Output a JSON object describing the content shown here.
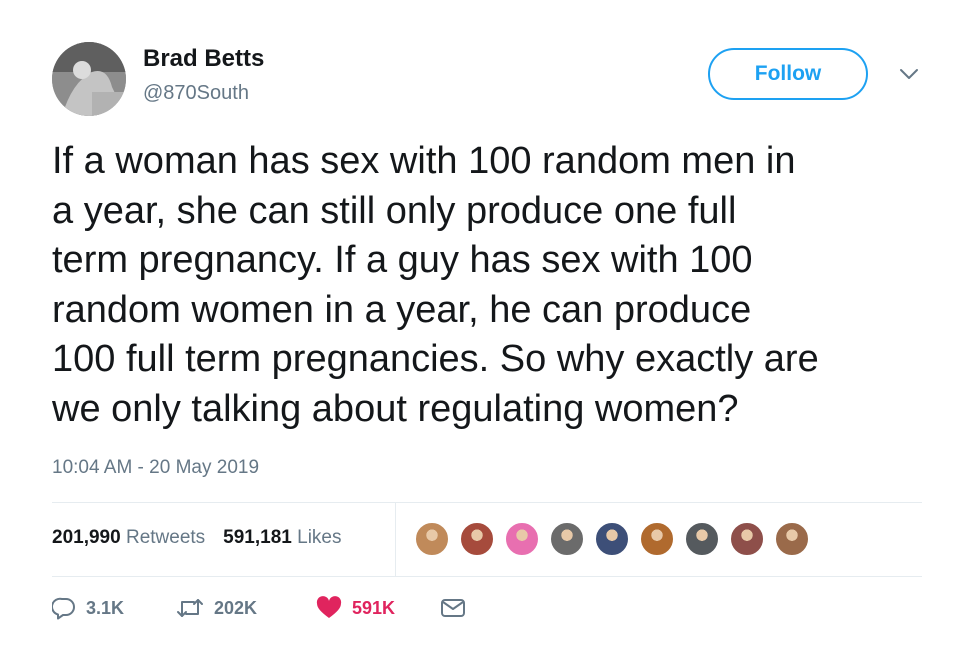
{
  "author": {
    "name": "Brad Betts",
    "handle": "@870South",
    "follow_label": "Follow"
  },
  "tweet": {
    "lines": [
      "If a woman has sex with 100 random men in",
      "a year, she can still only produce one full",
      "term pregnancy. If a guy has sex with 100",
      "random women in a year, he can produce",
      "100 full term pregnancies. So why exactly are",
      "we only talking about regulating women?"
    ],
    "timestamp": "10:04 AM - 20 May 2019"
  },
  "stats": {
    "retweets_count": "201,990",
    "retweets_label": "Retweets",
    "likes_count": "591,181",
    "likes_label": "Likes"
  },
  "likers": [
    {
      "color": "#c08a5a"
    },
    {
      "color": "#a64b3c"
    },
    {
      "color": "#e86fb0"
    },
    {
      "color": "#6b6b6b"
    },
    {
      "color": "#3d4f78"
    },
    {
      "color": "#b06a2e"
    },
    {
      "color": "#555a5e"
    },
    {
      "color": "#8e4f4a"
    },
    {
      "color": "#9a6a4a"
    }
  ],
  "actions": {
    "reply_count": "3.1K",
    "retweet_count": "202K",
    "like_count": "591K"
  },
  "colors": {
    "accent": "#1da1f2",
    "like": "#e0245e",
    "muted": "#657786"
  }
}
